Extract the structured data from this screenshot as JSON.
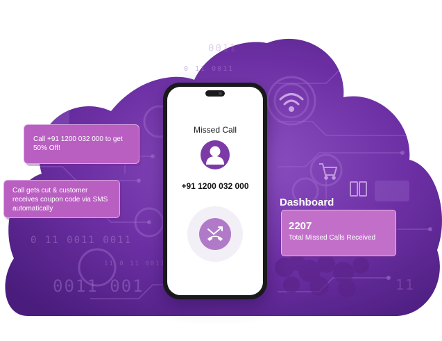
{
  "background": {
    "binary_texts": [
      "0 11 0011",
      "0 11 0011 0011",
      "11 0 11 0011 0011",
      "0011 001",
      "0011",
      "11"
    ],
    "colors": {
      "cloud_dark": "#3d1a6a",
      "cloud_mid": "#6a2fa0",
      "cloud_light": "#8a4bbf",
      "accent_pink": "#b95fc2"
    },
    "icons": [
      "wifi-icon",
      "cart-icon",
      "server-icon",
      "gear-icon",
      "circuit-icon"
    ]
  },
  "phone": {
    "screen_title": "Missed Call",
    "caller_number": "+91 1200 032 000",
    "avatar_icon": "person-icon",
    "call_button_icon": "missed-call-icon"
  },
  "bubbles": {
    "offer_text": "Call +91 1200 032 000 to get 50% Off!",
    "sms_text": "Call gets cut & customer receives coupon code via SMS automatically"
  },
  "dashboard": {
    "title": "Dashboard",
    "count": "2207",
    "label": "Total Missed Calls Received"
  }
}
